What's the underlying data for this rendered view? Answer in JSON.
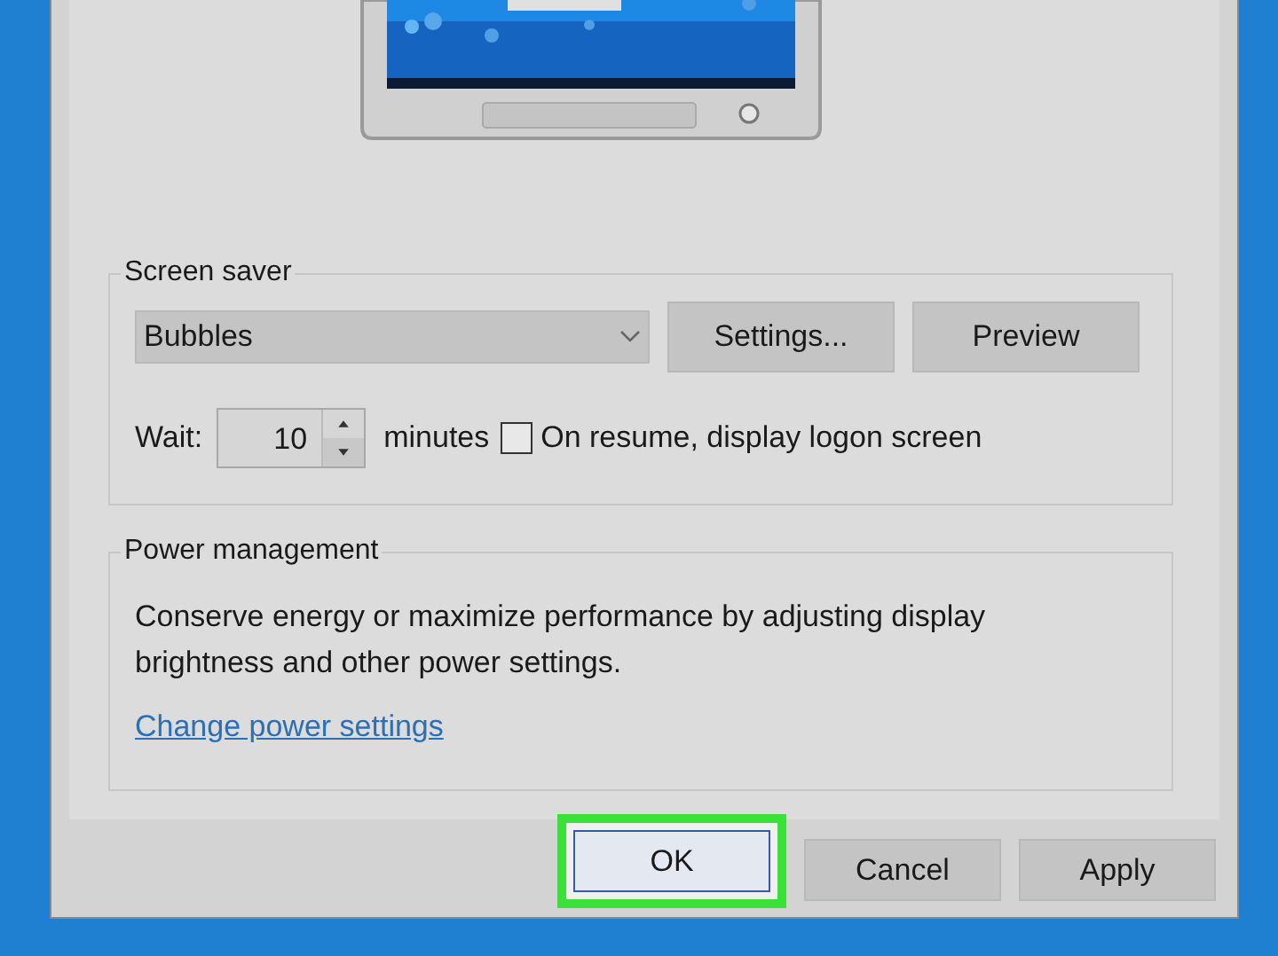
{
  "screen_saver": {
    "label": "Screen saver",
    "selected_saver": "Bubbles",
    "buttons": [
      "Settings...",
      "Preview"
    ],
    "wait_label": "Wait:",
    "wait_value": "10",
    "wait_unit": "minutes",
    "logon_checkbox": {
      "label": "On resume, display logon screen",
      "checked": false
    }
  },
  "power_management": {
    "label": "Power management",
    "description": "Conserve energy or maximize performance by adjusting display brightness and other power settings.",
    "link": "Change power settings"
  },
  "dialog_buttons": [
    {
      "label": "OK",
      "highlighted": true
    },
    {
      "label": "Cancel",
      "highlighted": false
    },
    {
      "label": "Apply",
      "highlighted": false
    }
  ]
}
